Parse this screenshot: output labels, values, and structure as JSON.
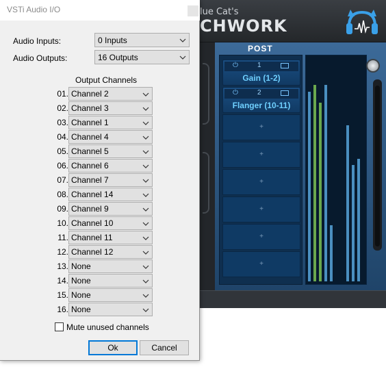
{
  "background_app": {
    "brand_line1": "lue Cat's",
    "brand_line2": "CHWORK",
    "post_label": "POST",
    "slots": [
      {
        "num": "1",
        "name": "Gain (1-2)",
        "power_icon": "power-icon"
      },
      {
        "num": "2",
        "name": "Flanger (10-11)",
        "power_icon": "power-icon"
      }
    ],
    "empty_slot_label": "+",
    "accent_color": "#2f6aa3",
    "meter_green": "#6aa94e",
    "meter_blue": "#4a8fc0",
    "meter_levels": [
      0.85,
      0.88,
      0.8,
      0.88,
      0.25,
      0.0,
      0.0,
      0.7,
      0.52,
      0.55
    ]
  },
  "dialog": {
    "title": "VSTi Audio I/O",
    "audio_inputs_label": "Audio Inputs:",
    "audio_inputs_value": "0 Inputs",
    "audio_outputs_label": "Audio Outputs:",
    "audio_outputs_value": "16 Outputs",
    "output_channels_title": "Output Channels",
    "channels": [
      {
        "num": "01.",
        "value": "Channel 2"
      },
      {
        "num": "02.",
        "value": "Channel 3"
      },
      {
        "num": "03.",
        "value": "Channel 1"
      },
      {
        "num": "04.",
        "value": "Channel 4"
      },
      {
        "num": "05.",
        "value": "Channel 5"
      },
      {
        "num": "06.",
        "value": "Channel 6"
      },
      {
        "num": "07.",
        "value": "Channel 7"
      },
      {
        "num": "08.",
        "value": "Channel 14"
      },
      {
        "num": "09.",
        "value": "Channel 9"
      },
      {
        "num": "10.",
        "value": "Channel 10"
      },
      {
        "num": "11.",
        "value": "Channel 11"
      },
      {
        "num": "12.",
        "value": "Channel 12"
      },
      {
        "num": "13.",
        "value": "None"
      },
      {
        "num": "14.",
        "value": "None"
      },
      {
        "num": "15.",
        "value": "None"
      },
      {
        "num": "16.",
        "value": "None"
      }
    ],
    "mute_unused_label": "Mute unused channels",
    "mute_unused_checked": false,
    "ok_label": "Ok",
    "cancel_label": "Cancel"
  }
}
